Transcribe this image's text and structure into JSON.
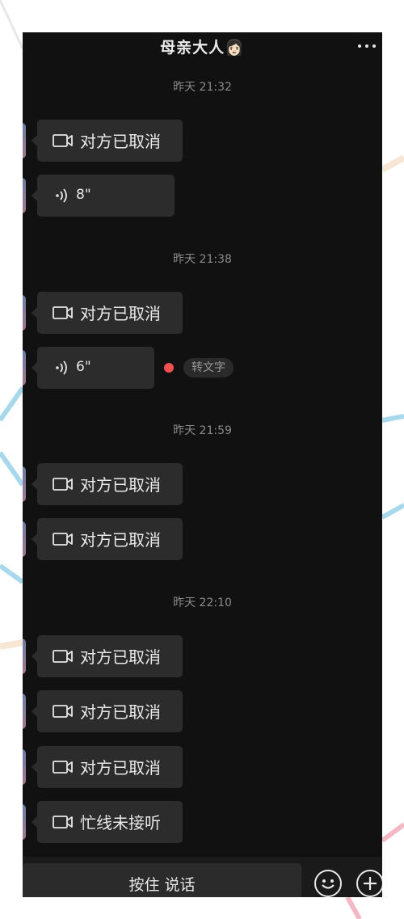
{
  "header": {
    "title": "母亲大人👩🏻"
  },
  "timestamps": [
    "昨天 21:32",
    "昨天 21:38",
    "昨天 21:59",
    "昨天 22:10"
  ],
  "messages": [
    {
      "type": "call",
      "text": "对方已取消"
    },
    {
      "type": "voice",
      "duration": "8\""
    },
    {
      "type": "call",
      "text": "对方已取消"
    },
    {
      "type": "voice",
      "duration": "6\"",
      "action": "转文字"
    },
    {
      "type": "call",
      "text": "对方已取消"
    },
    {
      "type": "call",
      "text": "对方已取消"
    },
    {
      "type": "call",
      "text": "对方已取消"
    },
    {
      "type": "call",
      "text": "对方已取消"
    },
    {
      "type": "call",
      "text": "对方已取消"
    },
    {
      "type": "call",
      "text": "忙线未接听"
    }
  ],
  "input": {
    "hold_to_talk": "按住 说话"
  },
  "icons": {
    "more": "more-icon",
    "call": "video-call-icon",
    "voice": "voice-wave-icon",
    "emoji": "emoji-icon",
    "add": "plus-icon"
  },
  "colors": {
    "unread": "#f25050",
    "background": "#111111",
    "bubble": "#2c2c2c"
  }
}
